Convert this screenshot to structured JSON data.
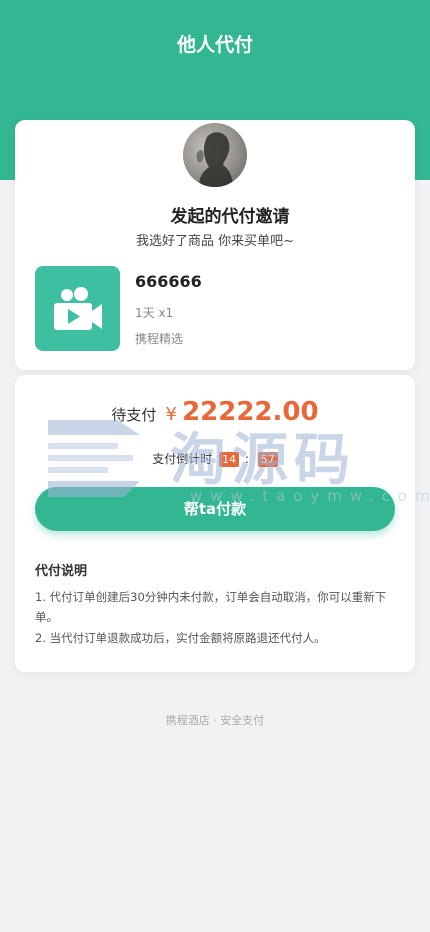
{
  "header": {
    "title": "他人代付",
    "color": "#33b793"
  },
  "invite": {
    "title": "发起的代付邀请",
    "subtitle": "我选好了商品 你来买单吧~"
  },
  "product": {
    "name": "666666",
    "spec": "1天 x1",
    "shop": "携程精选",
    "icon": "video-camera-icon"
  },
  "payment": {
    "label": "待支付",
    "currency": "¥",
    "amount": "22222.00",
    "countdown_label": "支付倒计时",
    "countdown_minutes": "14",
    "countdown_seconds": "57",
    "countdown_separator": ":",
    "button_label": "帮ta付款",
    "accent_color": "#e8683a"
  },
  "notes": {
    "title": "代付说明",
    "items": [
      "1. 代付订单创建后30分钟内未付款，订单会自动取消，你可以重新下单。",
      "2. 当代付订单退款成功后，实付金额将原路退还代付人。"
    ]
  },
  "footer": {
    "text": "携程酒店 · 安全支付"
  },
  "watermark": {
    "text": "淘源码",
    "url": "www.taoymw.com"
  }
}
